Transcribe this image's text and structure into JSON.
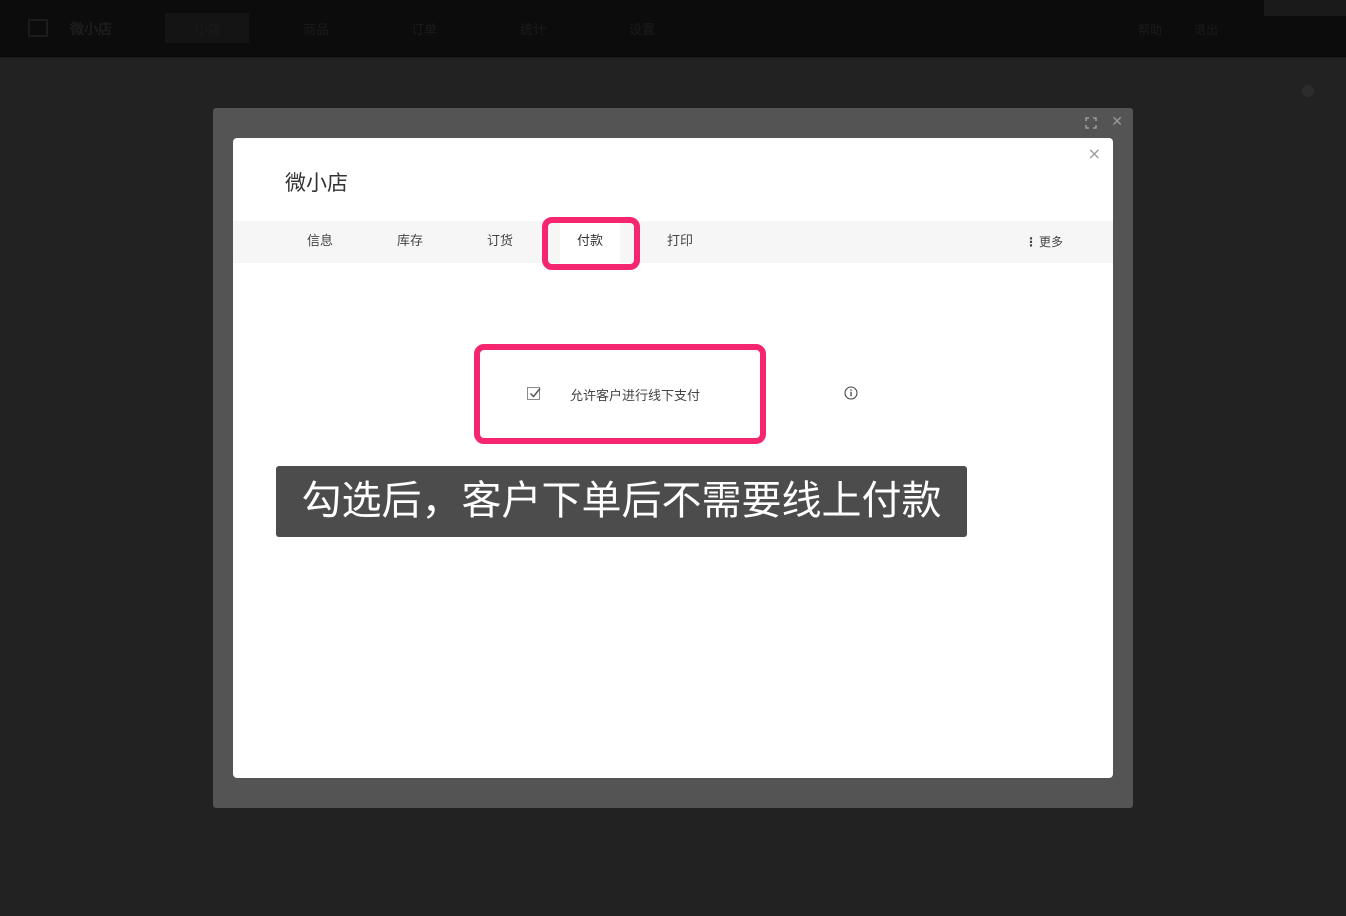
{
  "app": {
    "name": "微小店",
    "nav": [
      "小店",
      "商品",
      "订单",
      "统计",
      "设置"
    ],
    "right": [
      "帮助",
      "退出"
    ]
  },
  "dialog": {
    "title": "微小店",
    "close": "×",
    "tabs": [
      {
        "label": "信息"
      },
      {
        "label": "库存"
      },
      {
        "label": "订货"
      },
      {
        "label": "付款"
      },
      {
        "label": "打印"
      }
    ],
    "active_tab": "付款",
    "more_label": "更多",
    "option": {
      "label": "允许客户进行线下支付",
      "checked": true
    }
  },
  "caption": "勾选后，客户下单后不需要线上付款",
  "colors": {
    "highlight": "#f5266f",
    "caption_bg": "#4c4c4c"
  }
}
